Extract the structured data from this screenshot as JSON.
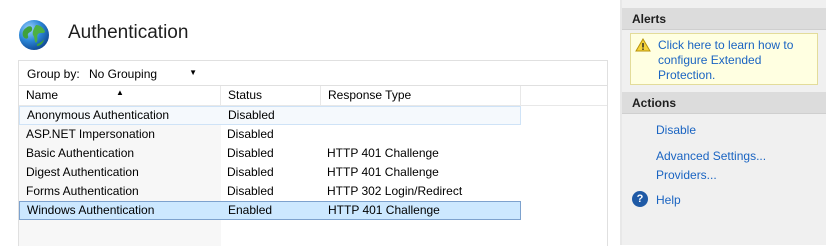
{
  "header": {
    "title": "Authentication"
  },
  "toolbar": {
    "group_by_label": "Group by:",
    "group_by_value": "No Grouping"
  },
  "table": {
    "columns": [
      "Name",
      "Status",
      "Response Type"
    ],
    "rows": [
      {
        "name": "Anonymous Authentication",
        "status": "Disabled",
        "response": ""
      },
      {
        "name": "ASP.NET Impersonation",
        "status": "Disabled",
        "response": ""
      },
      {
        "name": "Basic Authentication",
        "status": "Disabled",
        "response": "HTTP 401 Challenge"
      },
      {
        "name": "Digest Authentication",
        "status": "Disabled",
        "response": "HTTP 401 Challenge"
      },
      {
        "name": "Forms Authentication",
        "status": "Disabled",
        "response": "HTTP 302 Login/Redirect"
      },
      {
        "name": "Windows Authentication",
        "status": "Enabled",
        "response": "HTTP 401 Challenge"
      }
    ],
    "selected_row": "Windows Authentication",
    "sort_column": "Name"
  },
  "alerts": {
    "title": "Alerts",
    "message": "Click here to learn how to configure Extended Protection.",
    "icon": "warning-icon"
  },
  "actions": {
    "title": "Actions",
    "items": [
      "Disable",
      "Advanced Settings...",
      "Providers...",
      "Help"
    ],
    "help_icon": "help-icon"
  },
  "colors": {
    "link": "#1a64c2",
    "selection": "#cce8ff",
    "alert_background": "#ffffe1",
    "pane_header": "#dcdcdc"
  }
}
